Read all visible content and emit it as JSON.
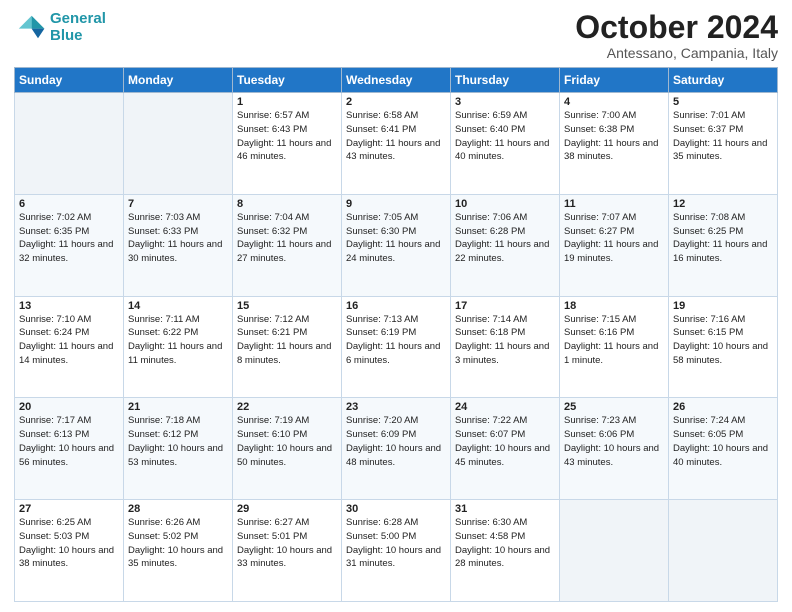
{
  "logo": {
    "line1": "General",
    "line2": "Blue"
  },
  "title": "October 2024",
  "subtitle": "Antessano, Campania, Italy",
  "columns": [
    "Sunday",
    "Monday",
    "Tuesday",
    "Wednesday",
    "Thursday",
    "Friday",
    "Saturday"
  ],
  "weeks": [
    [
      {
        "day": "",
        "sunrise": "",
        "sunset": "",
        "daylight": ""
      },
      {
        "day": "",
        "sunrise": "",
        "sunset": "",
        "daylight": ""
      },
      {
        "day": "1",
        "sunrise": "Sunrise: 6:57 AM",
        "sunset": "Sunset: 6:43 PM",
        "daylight": "Daylight: 11 hours and 46 minutes."
      },
      {
        "day": "2",
        "sunrise": "Sunrise: 6:58 AM",
        "sunset": "Sunset: 6:41 PM",
        "daylight": "Daylight: 11 hours and 43 minutes."
      },
      {
        "day": "3",
        "sunrise": "Sunrise: 6:59 AM",
        "sunset": "Sunset: 6:40 PM",
        "daylight": "Daylight: 11 hours and 40 minutes."
      },
      {
        "day": "4",
        "sunrise": "Sunrise: 7:00 AM",
        "sunset": "Sunset: 6:38 PM",
        "daylight": "Daylight: 11 hours and 38 minutes."
      },
      {
        "day": "5",
        "sunrise": "Sunrise: 7:01 AM",
        "sunset": "Sunset: 6:37 PM",
        "daylight": "Daylight: 11 hours and 35 minutes."
      }
    ],
    [
      {
        "day": "6",
        "sunrise": "Sunrise: 7:02 AM",
        "sunset": "Sunset: 6:35 PM",
        "daylight": "Daylight: 11 hours and 32 minutes."
      },
      {
        "day": "7",
        "sunrise": "Sunrise: 7:03 AM",
        "sunset": "Sunset: 6:33 PM",
        "daylight": "Daylight: 11 hours and 30 minutes."
      },
      {
        "day": "8",
        "sunrise": "Sunrise: 7:04 AM",
        "sunset": "Sunset: 6:32 PM",
        "daylight": "Daylight: 11 hours and 27 minutes."
      },
      {
        "day": "9",
        "sunrise": "Sunrise: 7:05 AM",
        "sunset": "Sunset: 6:30 PM",
        "daylight": "Daylight: 11 hours and 24 minutes."
      },
      {
        "day": "10",
        "sunrise": "Sunrise: 7:06 AM",
        "sunset": "Sunset: 6:28 PM",
        "daylight": "Daylight: 11 hours and 22 minutes."
      },
      {
        "day": "11",
        "sunrise": "Sunrise: 7:07 AM",
        "sunset": "Sunset: 6:27 PM",
        "daylight": "Daylight: 11 hours and 19 minutes."
      },
      {
        "day": "12",
        "sunrise": "Sunrise: 7:08 AM",
        "sunset": "Sunset: 6:25 PM",
        "daylight": "Daylight: 11 hours and 16 minutes."
      }
    ],
    [
      {
        "day": "13",
        "sunrise": "Sunrise: 7:10 AM",
        "sunset": "Sunset: 6:24 PM",
        "daylight": "Daylight: 11 hours and 14 minutes."
      },
      {
        "day": "14",
        "sunrise": "Sunrise: 7:11 AM",
        "sunset": "Sunset: 6:22 PM",
        "daylight": "Daylight: 11 hours and 11 minutes."
      },
      {
        "day": "15",
        "sunrise": "Sunrise: 7:12 AM",
        "sunset": "Sunset: 6:21 PM",
        "daylight": "Daylight: 11 hours and 8 minutes."
      },
      {
        "day": "16",
        "sunrise": "Sunrise: 7:13 AM",
        "sunset": "Sunset: 6:19 PM",
        "daylight": "Daylight: 11 hours and 6 minutes."
      },
      {
        "day": "17",
        "sunrise": "Sunrise: 7:14 AM",
        "sunset": "Sunset: 6:18 PM",
        "daylight": "Daylight: 11 hours and 3 minutes."
      },
      {
        "day": "18",
        "sunrise": "Sunrise: 7:15 AM",
        "sunset": "Sunset: 6:16 PM",
        "daylight": "Daylight: 11 hours and 1 minute."
      },
      {
        "day": "19",
        "sunrise": "Sunrise: 7:16 AM",
        "sunset": "Sunset: 6:15 PM",
        "daylight": "Daylight: 10 hours and 58 minutes."
      }
    ],
    [
      {
        "day": "20",
        "sunrise": "Sunrise: 7:17 AM",
        "sunset": "Sunset: 6:13 PM",
        "daylight": "Daylight: 10 hours and 56 minutes."
      },
      {
        "day": "21",
        "sunrise": "Sunrise: 7:18 AM",
        "sunset": "Sunset: 6:12 PM",
        "daylight": "Daylight: 10 hours and 53 minutes."
      },
      {
        "day": "22",
        "sunrise": "Sunrise: 7:19 AM",
        "sunset": "Sunset: 6:10 PM",
        "daylight": "Daylight: 10 hours and 50 minutes."
      },
      {
        "day": "23",
        "sunrise": "Sunrise: 7:20 AM",
        "sunset": "Sunset: 6:09 PM",
        "daylight": "Daylight: 10 hours and 48 minutes."
      },
      {
        "day": "24",
        "sunrise": "Sunrise: 7:22 AM",
        "sunset": "Sunset: 6:07 PM",
        "daylight": "Daylight: 10 hours and 45 minutes."
      },
      {
        "day": "25",
        "sunrise": "Sunrise: 7:23 AM",
        "sunset": "Sunset: 6:06 PM",
        "daylight": "Daylight: 10 hours and 43 minutes."
      },
      {
        "day": "26",
        "sunrise": "Sunrise: 7:24 AM",
        "sunset": "Sunset: 6:05 PM",
        "daylight": "Daylight: 10 hours and 40 minutes."
      }
    ],
    [
      {
        "day": "27",
        "sunrise": "Sunrise: 6:25 AM",
        "sunset": "Sunset: 5:03 PM",
        "daylight": "Daylight: 10 hours and 38 minutes."
      },
      {
        "day": "28",
        "sunrise": "Sunrise: 6:26 AM",
        "sunset": "Sunset: 5:02 PM",
        "daylight": "Daylight: 10 hours and 35 minutes."
      },
      {
        "day": "29",
        "sunrise": "Sunrise: 6:27 AM",
        "sunset": "Sunset: 5:01 PM",
        "daylight": "Daylight: 10 hours and 33 minutes."
      },
      {
        "day": "30",
        "sunrise": "Sunrise: 6:28 AM",
        "sunset": "Sunset: 5:00 PM",
        "daylight": "Daylight: 10 hours and 31 minutes."
      },
      {
        "day": "31",
        "sunrise": "Sunrise: 6:30 AM",
        "sunset": "Sunset: 4:58 PM",
        "daylight": "Daylight: 10 hours and 28 minutes."
      },
      {
        "day": "",
        "sunrise": "",
        "sunset": "",
        "daylight": ""
      },
      {
        "day": "",
        "sunrise": "",
        "sunset": "",
        "daylight": ""
      }
    ]
  ]
}
